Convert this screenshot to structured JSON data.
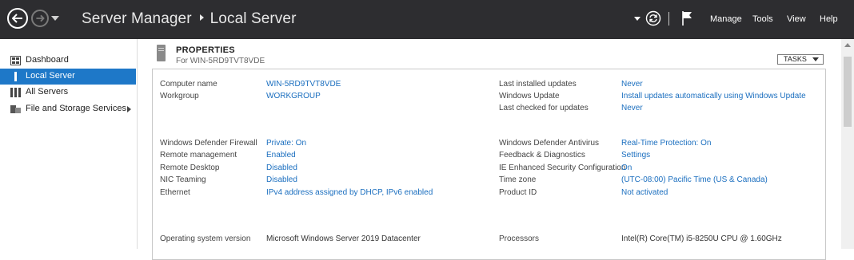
{
  "titlebar": {
    "app": "Server Manager",
    "page": "Local Server",
    "menu": {
      "manage": "Manage",
      "tools": "Tools",
      "view": "View",
      "help": "Help"
    }
  },
  "sidebar": {
    "items": [
      {
        "label": "Dashboard",
        "icon": "dashboard-icon"
      },
      {
        "label": "Local Server",
        "icon": "server-icon",
        "active": true
      },
      {
        "label": "All Servers",
        "icon": "servers-icon"
      },
      {
        "label": "File and Storage Services",
        "icon": "storage-icon",
        "expandable": true
      }
    ]
  },
  "properties": {
    "title": "PROPERTIES",
    "subtitle": "For WIN-5RD9TVT8VDE",
    "tasks_label": "TASKS",
    "left": [
      {
        "label": "Computer name",
        "value": "WIN-5RD9TVT8VDE"
      },
      {
        "label": "Workgroup",
        "value": "WORKGROUP"
      },
      {
        "label": "Windows Defender Firewall",
        "value": "Private: On"
      },
      {
        "label": "Remote management",
        "value": "Enabled"
      },
      {
        "label": "Remote Desktop",
        "value": "Disabled"
      },
      {
        "label": "NIC Teaming",
        "value": "Disabled"
      },
      {
        "label": "Ethernet",
        "value": "IPv4 address assigned by DHCP, IPv6 enabled"
      },
      {
        "label": "Operating system version",
        "value": "Microsoft Windows Server 2019 Datacenter"
      }
    ],
    "right": [
      {
        "label": "Last installed updates",
        "value": "Never"
      },
      {
        "label": "Windows Update",
        "value": "Install updates automatically using Windows Update"
      },
      {
        "label": "Last checked for updates",
        "value": "Never"
      },
      {
        "label": "Windows Defender Antivirus",
        "value": "Real-Time Protection: On"
      },
      {
        "label": "Feedback & Diagnostics",
        "value": "Settings"
      },
      {
        "label": "IE Enhanced Security Configuration",
        "value": "On"
      },
      {
        "label": "Time zone",
        "value": "(UTC-08:00) Pacific Time (US & Canada)"
      },
      {
        "label": "Product ID",
        "value": "Not activated"
      },
      {
        "label": "Processors",
        "value": "Intel(R) Core(TM) i5-8250U CPU @ 1.60GHz"
      }
    ]
  },
  "colors": {
    "titlebar_bg": "#2d2d30",
    "accent": "#1e78c8",
    "link": "#1a6ebf"
  }
}
